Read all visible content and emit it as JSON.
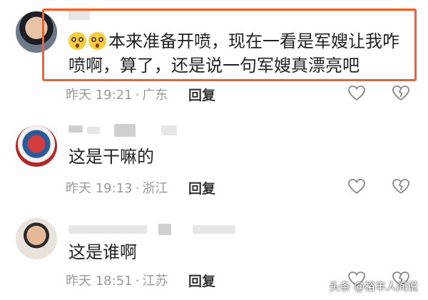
{
  "comments": [
    {
      "text_line1": "本来准备开喷，现在一看是军嫂让我咋",
      "text_line2": "喷啊，算了，还是说一句军嫂真漂亮吧",
      "time": "昨天 19:21",
      "location": "广东",
      "reply_label": "回复"
    },
    {
      "text": "这是干嘛的",
      "time": "昨天 19:13",
      "location": "浙江",
      "reply_label": "回复"
    },
    {
      "text": "这是谁啊",
      "time": "昨天 18:51",
      "location": "江苏",
      "reply_label": "回复"
    }
  ],
  "separator": "·",
  "watermark": "头条 @裕丰人间说",
  "icons": {
    "like": "heart-icon",
    "dislike": "broken-heart-icon",
    "emoji": "astonished-face-emoji"
  },
  "colors": {
    "highlight_border": "#ff5a1f",
    "meta_text": "#999999",
    "body_text": "#222222"
  }
}
